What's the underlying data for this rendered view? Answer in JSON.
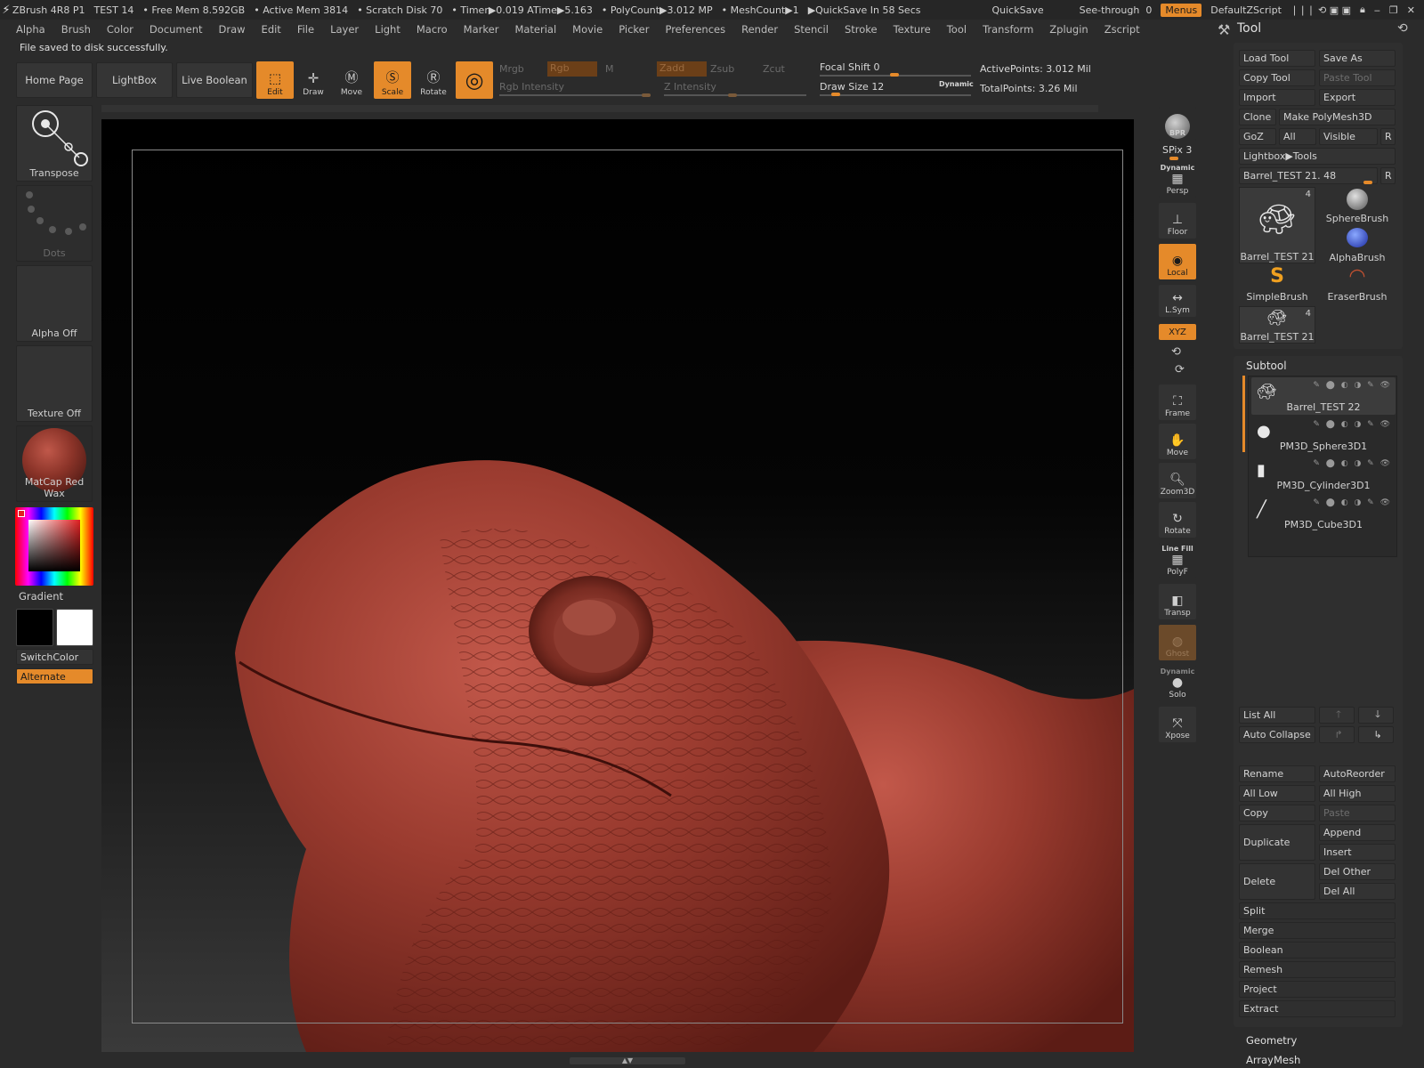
{
  "titlebar": {
    "app": "ZBrush 4R8 P1",
    "doc": "TEST 14",
    "free_mem": "• Free Mem 8.592GB",
    "active_mem": "• Active Mem 3814",
    "scratch": "• Scratch Disk 70",
    "timer": "• Timer▶0.019 ATime▶5.163",
    "polycount": "• PolyCount▶3.012 MP",
    "meshcount": "• MeshCount▶1",
    "quicksave_in": "▶QuickSave In 58 Secs",
    "quicksave": "QuickSave",
    "see_through_label": "See-through",
    "see_through_value": "0",
    "menus": "Menus",
    "script": "DefaultZScript"
  },
  "menubar": [
    "Alpha",
    "Brush",
    "Color",
    "Document",
    "Draw",
    "Edit",
    "File",
    "Layer",
    "Light",
    "Macro",
    "Marker",
    "Material",
    "Movie",
    "Picker",
    "Preferences",
    "Render",
    "Stencil",
    "Stroke",
    "Texture",
    "Tool",
    "Transform",
    "Zplugin",
    "Zscript"
  ],
  "status": "File saved to disk successfully.",
  "shelf": {
    "home_page": "Home Page",
    "lightbox": "LightBox",
    "live_boolean": "Live Boolean",
    "edit": "Edit",
    "draw": "Draw",
    "move": "Move",
    "scale": "Scale",
    "rotate": "Rotate",
    "mrgb": "Mrgb",
    "rgb": "Rgb",
    "m": "M",
    "zadd": "Zadd",
    "zsub": "Zsub",
    "zcut": "Zcut",
    "rgb_intensity": "Rgb Intensity",
    "z_intensity": "Z Intensity",
    "focal_shift_label": "Focal Shift",
    "focal_shift_value": "0",
    "draw_size_label": "Draw Size",
    "draw_size_value": "12",
    "dynamic": "Dynamic",
    "active_points": "ActivePoints: 3.012 Mil",
    "total_points": "TotalPoints: 3.26 Mil"
  },
  "left": {
    "transpose": "Transpose",
    "dots": "Dots",
    "alpha": "Alpha Off",
    "texture": "Texture Off",
    "material": "MatCap Red Wax",
    "gradient": "Gradient",
    "switch_color": "SwitchColor",
    "alternate": "Alternate"
  },
  "nav": {
    "bpr": "BPR",
    "spix": "SPix 3",
    "dynamic": "Dynamic",
    "persp": "Persp",
    "floor": "Floor",
    "local": "Local",
    "lsym": "L.Sym",
    "xyz": "XYZ",
    "frame": "Frame",
    "move": "Move",
    "zoom3d": "Zoom3D",
    "rotate": "Rotate",
    "line_fill": "Line Fill",
    "polyf": "PolyF",
    "transp": "Transp",
    "ghost": "Ghost",
    "dynamic2": "Dynamic",
    "solo": "Solo",
    "xpose": "Xpose"
  },
  "tool": {
    "title": "Tool",
    "load_tool": "Load Tool",
    "save_as": "Save As",
    "copy_tool": "Copy Tool",
    "paste_tool": "Paste Tool",
    "import": "Import",
    "export": "Export",
    "clone": "Clone",
    "make_polymesh": "Make PolyMesh3D",
    "goz": "GoZ",
    "all": "All",
    "visible": "Visible",
    "r": "R",
    "lightbox_tools": "Lightbox▶Tools",
    "current_tool": "Barrel_TEST 21. 48",
    "thumbs": [
      {
        "name": "Barrel_TEST 21",
        "count": "4"
      },
      {
        "name": "SphereBrush",
        "count": ""
      },
      {
        "name": "AlphaBrush",
        "count": ""
      },
      {
        "name": "SimpleBrush",
        "count": ""
      },
      {
        "name": "EraserBrush",
        "count": ""
      },
      {
        "name": "Barrel_TEST 21",
        "count": "4"
      }
    ]
  },
  "subtool": {
    "title": "Subtool",
    "items": [
      {
        "name": "Barrel_TEST 22"
      },
      {
        "name": "PM3D_Sphere3D1"
      },
      {
        "name": "PM3D_Cylinder3D1"
      },
      {
        "name": "PM3D_Cube3D1"
      }
    ],
    "list_all": "List All",
    "auto_collapse": "Auto Collapse",
    "rename": "Rename",
    "autoreorder": "AutoReorder",
    "all_low": "All Low",
    "all_high": "All High",
    "copy": "Copy",
    "paste": "Paste",
    "duplicate": "Duplicate",
    "append": "Append",
    "insert": "Insert",
    "delete": "Delete",
    "del_other": "Del Other",
    "del_all": "Del All",
    "split": "Split",
    "merge": "Merge",
    "boolean": "Boolean",
    "remesh": "Remesh",
    "project": "Project",
    "extract": "Extract",
    "geometry": "Geometry",
    "arraymesh": "ArrayMesh"
  },
  "colors": {
    "accent": "#e58a2a",
    "model": "#8a3328"
  }
}
